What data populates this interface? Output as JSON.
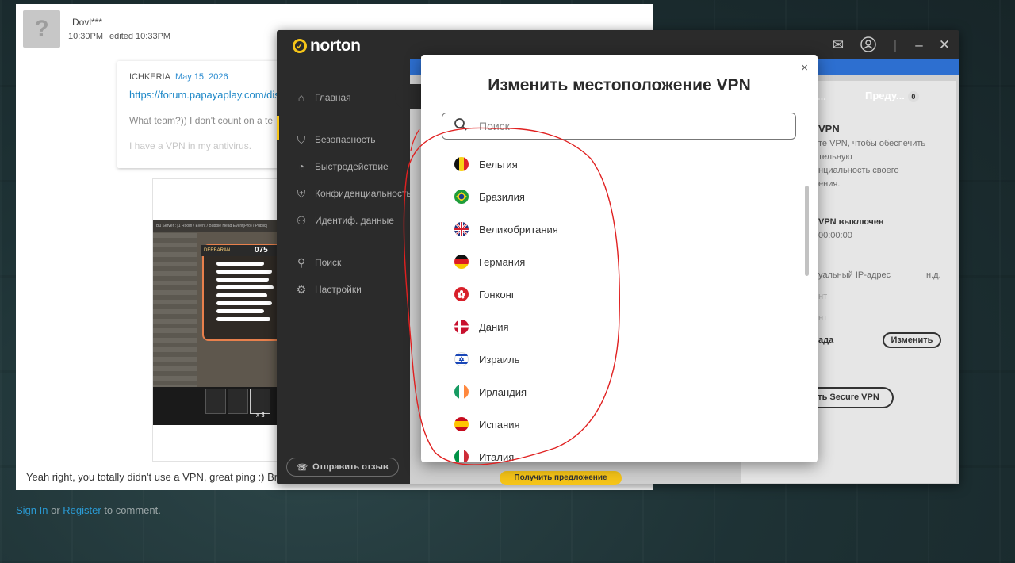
{
  "forum": {
    "post_author": "Dovl***",
    "post_time": "10:30PM",
    "post_edited": "edited 10:33PM",
    "quote_author": "ICHKERIA",
    "quote_date": "May 15, 2026",
    "quote_link": "https://forum.papayaplay.com/dis",
    "quote_text": "What team?)) I don't count on a te",
    "quote_text2": "I have a VPN in my antivirus.",
    "game": {
      "topbar": "Bu Server : [1 Room / Event / Bubble Head Event(Pro) / Public]",
      "player": "DERBARAN",
      "score": "075",
      "multiplier": "x 3"
    },
    "reply_text": "Yeah right, you totally didn't use a VPN, great ping :) Braz",
    "signin_link": "Sign In",
    "or_text": " or ",
    "register_link": "Register",
    "comment_text": " to comment."
  },
  "norton": {
    "brand": "norton",
    "nav": [
      "Главная",
      "Безопасность",
      "Быстродействие",
      "Конфиденциальность",
      "Идентиф. данные",
      "Поиск",
      "Настройки"
    ],
    "feedback_button": "Отправить отзыв",
    "tab_prev": "...",
    "tab_label": "Преду...",
    "tab_badge": "0",
    "vpn_heading": "VPN",
    "vpn_desc": [
      "те VPN, чтобы обеспечить",
      "тельную",
      "нциальность своего",
      "ения."
    ],
    "vpn_status": "VPN выключен",
    "vpn_timer": "00:00:00",
    "virtual_ip_label": "уальный IP-адрес",
    "virtual_ip_value": "н.д.",
    "row_faint1": "нт",
    "row_faint2": "нт",
    "region_label": "ада",
    "change_button": "Изменить",
    "secure_vpn_button": "ть Secure VPN",
    "offer_button": "Получить предложение"
  },
  "modal": {
    "title": "Изменить местоположение VPN",
    "search_placeholder": "Поиск",
    "countries": [
      {
        "name": "Бельгия",
        "flag": "belgium-flag-icon"
      },
      {
        "name": "Бразилия",
        "flag": "brazil-flag-icon"
      },
      {
        "name": "Великобритания",
        "flag": "uk-flag-icon"
      },
      {
        "name": "Германия",
        "flag": "germany-flag-icon"
      },
      {
        "name": "Гонконг",
        "flag": "hongkong-flag-icon"
      },
      {
        "name": "Дания",
        "flag": "denmark-flag-icon"
      },
      {
        "name": "Израиль",
        "flag": "israel-flag-icon"
      },
      {
        "name": "Ирландия",
        "flag": "ireland-flag-icon"
      },
      {
        "name": "Испания",
        "flag": "spain-flag-icon"
      },
      {
        "name": "Италия",
        "flag": "italy-flag-icon"
      }
    ]
  },
  "colors": {
    "norton_yellow": "#f5c418",
    "annotation_red": "#e02020",
    "link_blue": "#2a9ad4"
  }
}
